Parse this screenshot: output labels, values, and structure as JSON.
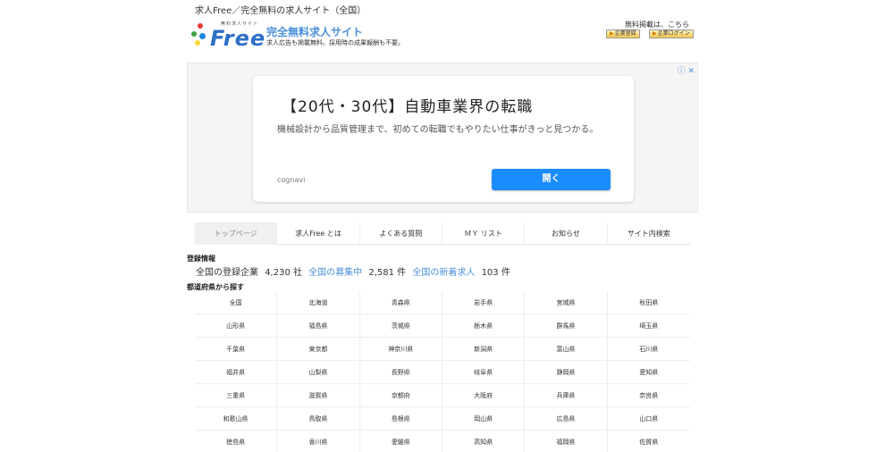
{
  "page": {
    "title": "求人Free／完全無料の求人サイト（全国）"
  },
  "logo": {
    "small_text": "無料求人サイト",
    "word": "Free"
  },
  "header": {
    "site_name": "完全無料求人サイト",
    "tagline": "求人広告も掲載無料。採用時の成果報酬も不要。"
  },
  "corp": {
    "label": "無料掲載は、こちら",
    "register_label": "企業登録",
    "login_label": "企業ログイン"
  },
  "ad": {
    "headline": "【20代・30代】自動車業界の転職",
    "body": "機械設計から品質管理まで、初めての転職でもやりたい仕事がきっと見つかる。",
    "source": "cognavi",
    "button": "開く",
    "info_icon": "info-icon",
    "close_icon": "close-icon"
  },
  "nav": [
    {
      "label": "トップページ",
      "active": true
    },
    {
      "label": "求人Free とは"
    },
    {
      "label": "よくある質問"
    },
    {
      "label": "ＭＹ リスト"
    },
    {
      "label": "お知らせ"
    },
    {
      "label": "サイト内検索"
    }
  ],
  "registration": {
    "title": "登録情報",
    "companies_label": "全国の登録企業",
    "companies_value": "4,230 社",
    "recruiting_label": "全国の募集中",
    "recruiting_value": "2,581 件",
    "new_label": "全国の新着求人",
    "new_value": "103 件"
  },
  "prefectures": {
    "title": "都道府県から探す",
    "items": [
      "全国",
      "北海道",
      "青森県",
      "岩手県",
      "宮城県",
      "秋田県",
      "山形県",
      "福島県",
      "茨城県",
      "栃木県",
      "群馬県",
      "埼玉県",
      "千葉県",
      "東京都",
      "神奈川県",
      "新潟県",
      "富山県",
      "石川県",
      "福井県",
      "山梨県",
      "長野県",
      "岐阜県",
      "静岡県",
      "愛知県",
      "三重県",
      "滋賀県",
      "京都府",
      "大阪府",
      "兵庫県",
      "奈良県",
      "和歌山県",
      "鳥取県",
      "島根県",
      "岡山県",
      "広島県",
      "山口県",
      "徳島県",
      "香川県",
      "愛媛県",
      "高知県",
      "福岡県",
      "佐賀県"
    ]
  },
  "colors": {
    "accent": "#4a90d9",
    "ad_button": "#1a8cff",
    "logo": "#2e6fc7"
  }
}
